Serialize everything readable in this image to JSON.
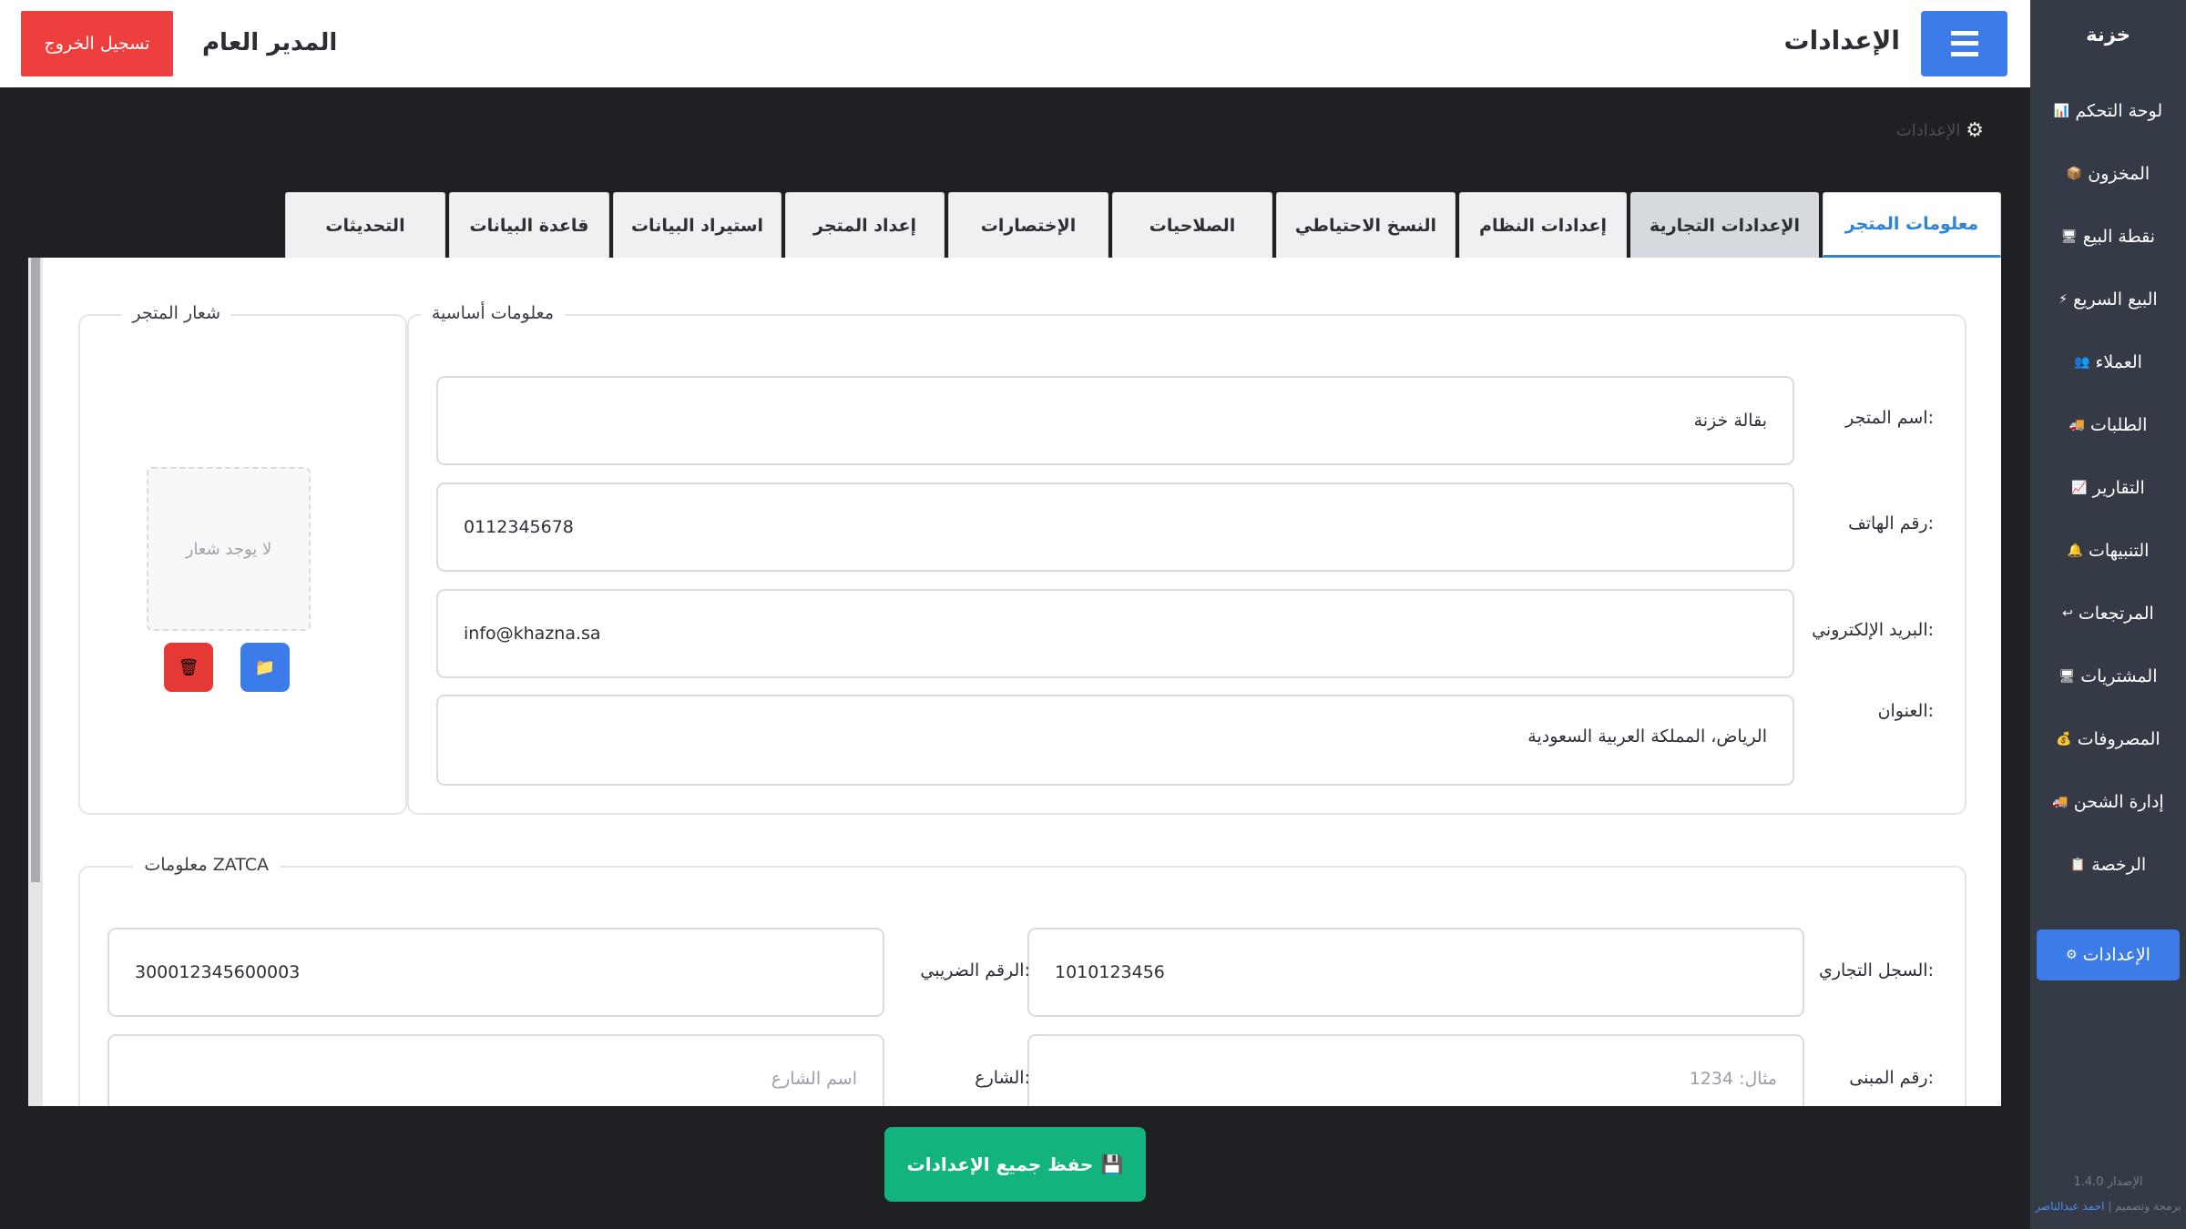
{
  "sidebar": {
    "brand": "خزنة",
    "items": [
      {
        "label": "لوحة التحكم",
        "icon": "📊"
      },
      {
        "label": "المخزون",
        "icon": "📦"
      },
      {
        "label": "نقطة البيع",
        "icon": "🖥"
      },
      {
        "label": "البيع السريع",
        "icon": "⚡"
      },
      {
        "label": "العملاء",
        "icon": "👥"
      },
      {
        "label": "الطلبات",
        "icon": "🚚"
      },
      {
        "label": "التقارير",
        "icon": "📈"
      },
      {
        "label": "التنبيهات",
        "icon": "🔔"
      },
      {
        "label": "المرتجعات",
        "icon": "↩"
      },
      {
        "label": "المشتريات",
        "icon": "🖥"
      },
      {
        "label": "المصروفات",
        "icon": "💰"
      },
      {
        "label": "إدارة الشحن",
        "icon": "🚚"
      },
      {
        "label": "الرخصة",
        "icon": "📋"
      },
      {
        "label": "الإعدادات",
        "icon": "⚙"
      }
    ],
    "active_index": 13,
    "version": "الإصدار 1.4.0",
    "credit_prefix": "برمجة وتصميم |",
    "credit_author": "احمد عبدالناصر"
  },
  "header": {
    "page_title": "الإعدادات",
    "user_name": "المدير العام",
    "logout_label": "تسجيل الخروج"
  },
  "breadcrumb": {
    "icon": "⚙",
    "label": "الإعدادات"
  },
  "tabs": [
    {
      "label": "معلومات المتجر"
    },
    {
      "label": "الإعدادات التجارية"
    },
    {
      "label": "إعدادات النظام"
    },
    {
      "label": "النسخ الاحتياطي"
    },
    {
      "label": "الصلاحيات"
    },
    {
      "label": "الإختصارات"
    },
    {
      "label": "إعداد المتجر"
    },
    {
      "label": "استيراد البيانات"
    },
    {
      "label": "قاعدة البيانات"
    },
    {
      "label": "التحديثات"
    }
  ],
  "basic_info": {
    "legend": "معلومات أساسية",
    "store_name_label": "اسم المتجر:",
    "store_name_value": "بقالة خزنة",
    "phone_label": "رقم الهاتف:",
    "phone_value": "0112345678",
    "email_label": "البريد الإلكتروني:",
    "email_value": "info@khazna.sa",
    "address_label": "العنوان:",
    "address_value": "الرياض، المملكة العربية السعودية"
  },
  "logo": {
    "legend": "شعار المتجر",
    "empty_text": "لا يوجد شعار",
    "browse_icon": "📁",
    "delete_icon": "🗑"
  },
  "zatca": {
    "legend": "معلومات ZATCA",
    "cr_label": "السجل التجاري:",
    "cr_value": "1010123456",
    "vat_label": "الرقم الضريبي:",
    "vat_value": "300012345600003",
    "building_label": "رقم المبنى:",
    "building_placeholder": "مثال: 1234",
    "street_label": "الشارع:",
    "street_placeholder": "اسم الشارع"
  },
  "save": {
    "label": "حفظ جميع الإعدادات",
    "icon": "💾"
  },
  "colors": {
    "accent": "#3b7ce8",
    "danger": "#ee3f3f",
    "success": "#13b37e",
    "sidebar": "#343a46",
    "active_tab_text": "#2d84d8"
  }
}
